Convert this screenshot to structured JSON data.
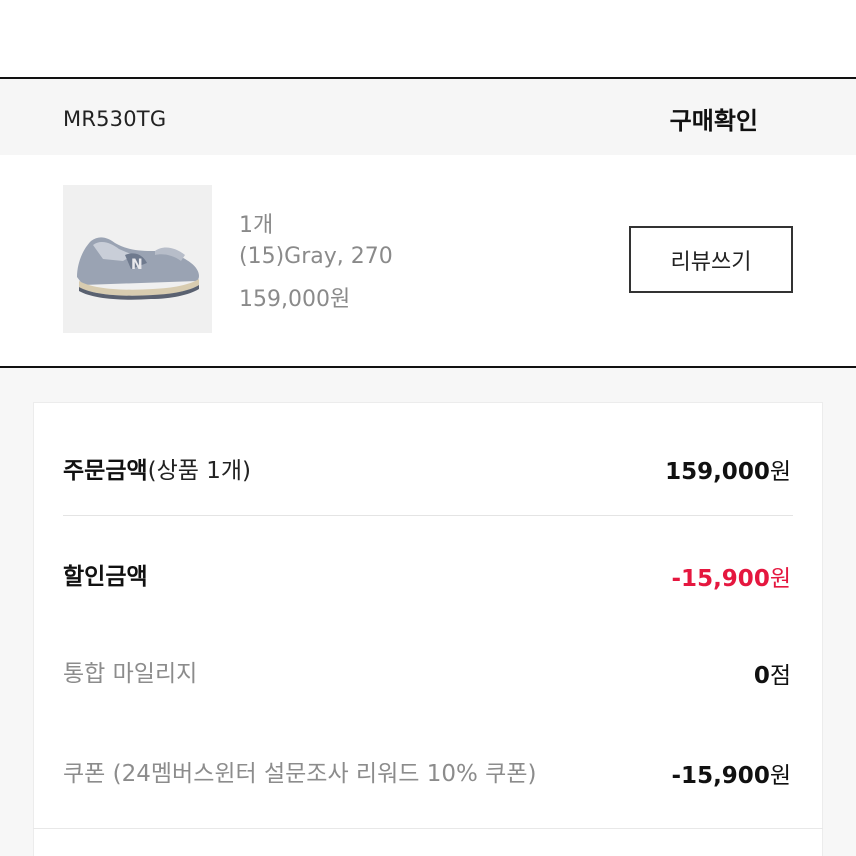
{
  "order": {
    "product_code": "MR530TG",
    "status_action": "구매확인",
    "item": {
      "image_icon": "sneaker-product-image",
      "quantity": "1개",
      "option": "(15)Gray, 270",
      "price": "159,000원"
    },
    "review_label": "리뷰쓰기"
  },
  "summary": {
    "order_amount": {
      "label": "주문금액",
      "sub": "(상품 1개)",
      "amount": "159,000",
      "unit": "원"
    },
    "discount": {
      "label": "할인금액",
      "amount": "-15,900",
      "unit": "원"
    },
    "mileage": {
      "label": "통합 마일리지",
      "amount": "0",
      "unit": "점"
    },
    "coupon": {
      "label": "쿠폰 (24멤버스윈터 설문조사 리워드 10% 쿠폰)",
      "amount": "-15,900",
      "unit": "원"
    }
  },
  "colors": {
    "accent_red": "#e5173f",
    "divider": "#111111"
  }
}
